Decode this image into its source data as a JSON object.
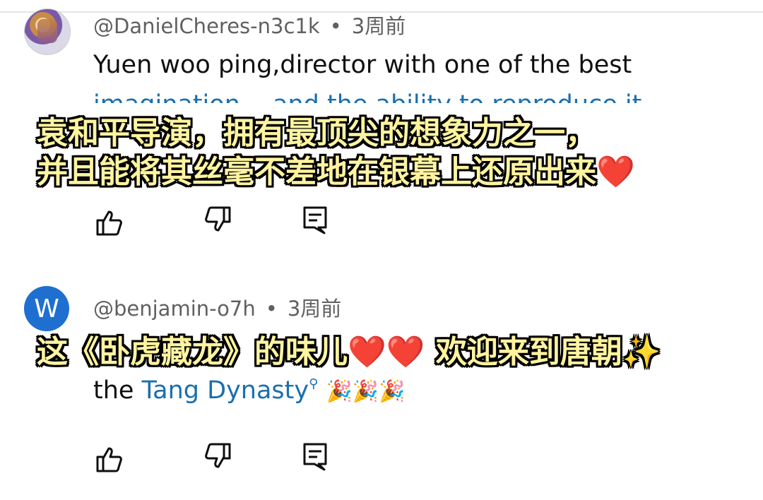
{
  "comments": [
    {
      "author": "@DanielCheres-n3c1k",
      "time": "3周前",
      "text": "Yuen woo ping,director with one of the best",
      "text_cut": "imagination… and the ability to reproduce it",
      "avatar_icon": "avatar-image"
    },
    {
      "author": "@benjamin-o7h",
      "time": "3周前",
      "avatar_letter": "W",
      "text_before_link": "the ",
      "link": "Tang Dynasty",
      "emojis": "🎉🎉🎉"
    }
  ],
  "separator": "•",
  "overlays": {
    "line1": "袁和平导演，拥有最顶尖的想象力之一，",
    "line2": "并且能将其丝毫不差地在银幕上还原出来",
    "line3_a": "这《卧虎藏龙》的味儿",
    "line3_b": " 欢迎来到唐朝",
    "heart": "❤️",
    "sparkle": "✨"
  },
  "actions": {
    "like_icon": "thumbs-up-icon",
    "dislike_icon": "thumbs-down-icon",
    "reply_icon": "reply-comment-icon"
  },
  "colors": {
    "overlay_fill": "#fff4a0",
    "link": "#1a6fb0",
    "avatar_w": "#1e6fd0"
  }
}
